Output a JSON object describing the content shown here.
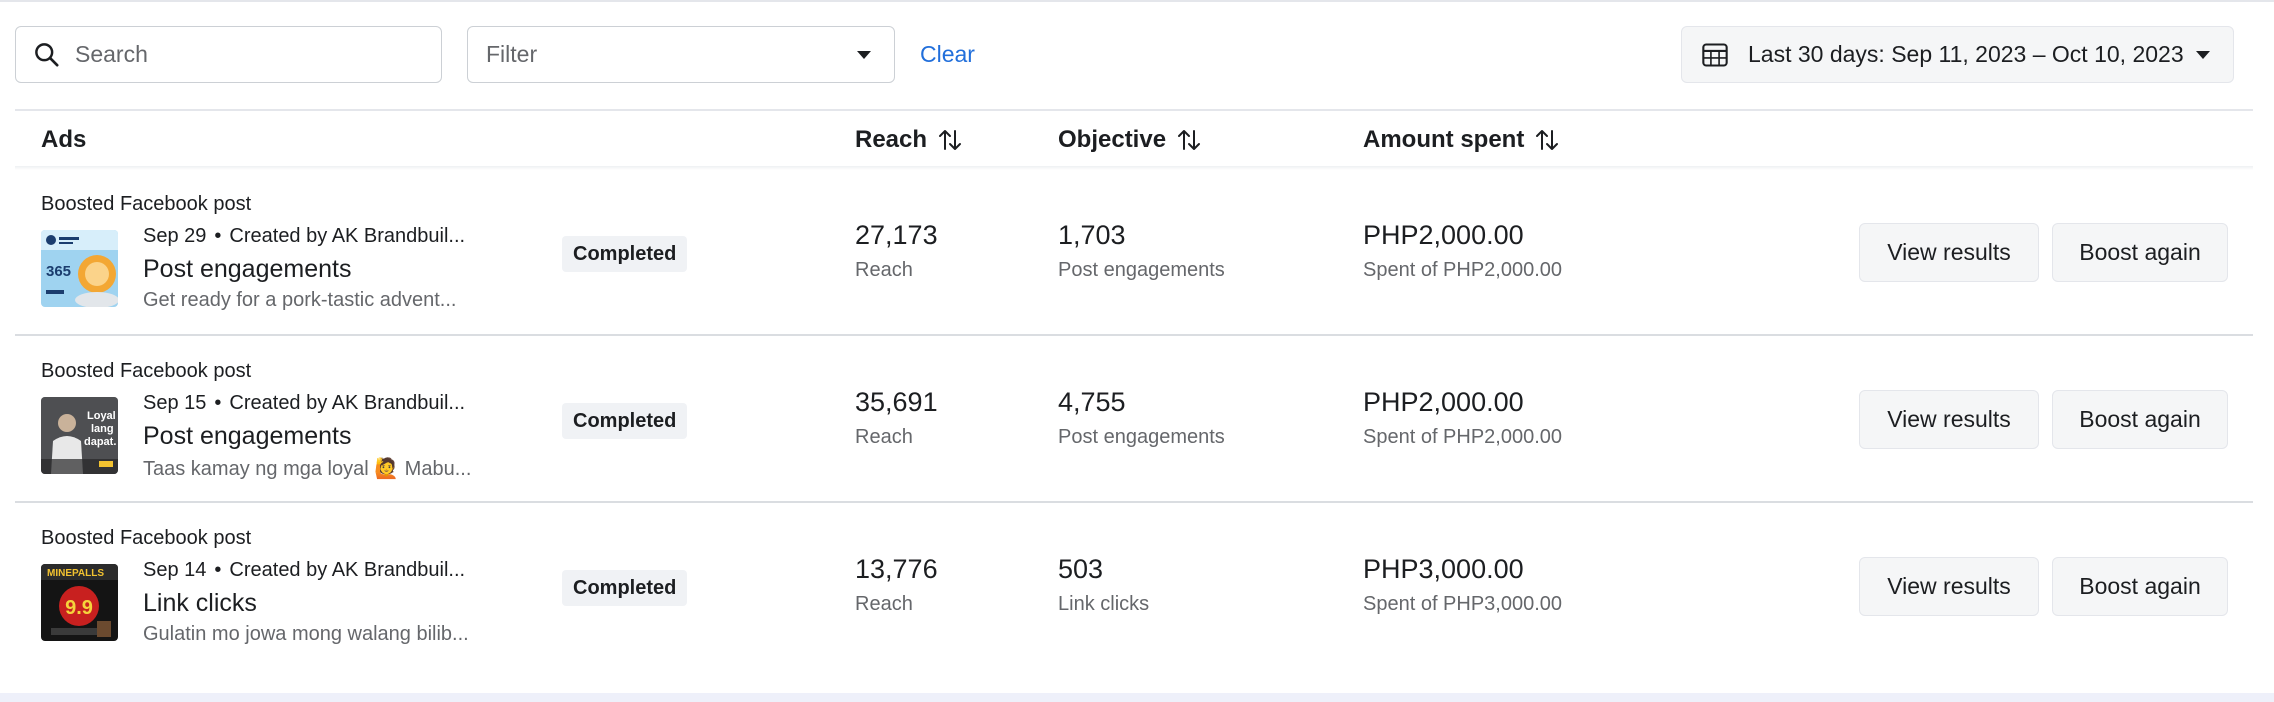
{
  "toolbar": {
    "search_placeholder": "Search",
    "filter_placeholder": "Filter",
    "clear_label": "Clear",
    "date_range_label": "Last 30 days: Sep 11, 2023 – Oct 10, 2023"
  },
  "table": {
    "columns": {
      "ads": "Ads",
      "reach": "Reach",
      "objective": "Objective",
      "amount_spent": "Amount spent"
    },
    "rows": [
      {
        "type": "Boosted Facebook post",
        "date": "Sep 29",
        "creator": "Created by AK Brandbuil...",
        "title": "Post engagements",
        "description": "Get ready for a pork-tastic advent...",
        "status": "Completed",
        "reach_value": "27,173",
        "reach_label": "Reach",
        "objective_value": "1,703",
        "objective_label": "Post engagements",
        "amount_value": "PHP2,000.00",
        "amount_label": "Spent of PHP2,000.00",
        "view_label": "View results",
        "boost_label": "Boost again",
        "thumb_text": "365"
      },
      {
        "type": "Boosted Facebook post",
        "date": "Sep 15",
        "creator": "Created by AK Brandbuil...",
        "title": "Post engagements",
        "description": "Taas kamay ng mga loyal 🙋 Mabu...",
        "status": "Completed",
        "reach_value": "35,691",
        "reach_label": "Reach",
        "objective_value": "4,755",
        "objective_label": "Post engagements",
        "amount_value": "PHP2,000.00",
        "amount_label": "Spent of PHP2,000.00",
        "view_label": "View results",
        "boost_label": "Boost again",
        "thumb_text": "Loyal lang dapat."
      },
      {
        "type": "Boosted Facebook post",
        "date": "Sep 14",
        "creator": "Created by AK Brandbuil...",
        "title": "Link clicks",
        "description": "Gulatin mo jowa mong walang bilib...",
        "status": "Completed",
        "reach_value": "13,776",
        "reach_label": "Reach",
        "objective_value": "503",
        "objective_label": "Link clicks",
        "amount_value": "PHP3,000.00",
        "amount_label": "Spent of PHP3,000.00",
        "view_label": "View results",
        "boost_label": "Boost again",
        "thumb_text": "9.9"
      }
    ]
  },
  "icons": {
    "search": "search-icon",
    "filter_caret": "caret-down-icon",
    "calendar": "calendar-grid-icon",
    "sort": "sort-arrows-icon"
  },
  "colors": {
    "link": "#216fdb",
    "muted_text": "#65676b",
    "button_bg": "#f5f6f7"
  }
}
